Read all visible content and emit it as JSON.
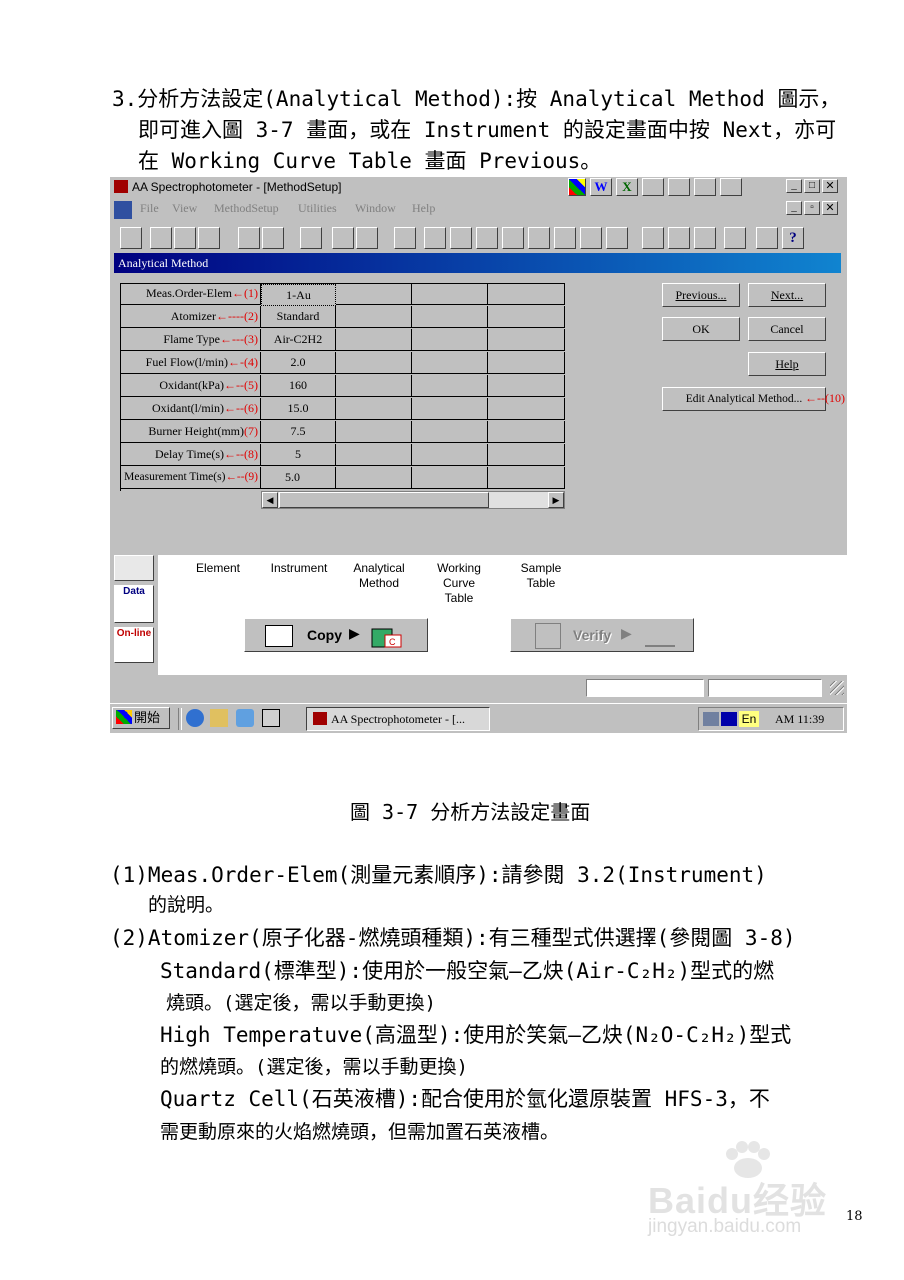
{
  "intro": {
    "line1": "3.分析方法設定(Analytical Method):按 Analytical Method 圖示，",
    "line2": "即可進入圖 3-7 畫面，或在 Instrument 的設定畫面中按 Next，亦可",
    "line3": "在 Working Curve Table 畫面 Previous。"
  },
  "window": {
    "title": "AA Spectrophotometer - [MethodSetup]",
    "menu": [
      "File",
      "View",
      "MethodSetup",
      "Utilities",
      "Window",
      "Help"
    ],
    "dialog_title": "Analytical Method",
    "params": [
      {
        "label": "Meas.Order-Elem",
        "mark": "←(1)",
        "value": "1-Au"
      },
      {
        "label": "Atomizer",
        "mark": "←----(2)",
        "value": "Standard"
      },
      {
        "label": "Flame Type",
        "mark": "←---(3)",
        "value": "Air-C2H2"
      },
      {
        "label": "Fuel Flow(l/min)",
        "mark": "←-(4)",
        "value": "2.0"
      },
      {
        "label": "Oxidant(kPa)",
        "mark": "←--(5)",
        "value": "160"
      },
      {
        "label": "Oxidant(l/min)",
        "mark": "←--(6)",
        "value": "15.0"
      },
      {
        "label": "Burner Height(mm)",
        "mark": "(7)",
        "value": "7.5"
      },
      {
        "label": "Delay Time(s)",
        "mark": "←--(8)",
        "value": "5"
      },
      {
        "label": "Measurement Time(s)",
        "mark": "←--(9)",
        "value": "5.0"
      }
    ],
    "buttons": {
      "previous": "Previous...",
      "next": "Next...",
      "ok": "OK",
      "cancel": "Cancel",
      "help": "Help",
      "edit": "Edit Analytical Method...",
      "edit_mark": "←--(10)"
    },
    "steps": [
      "Element",
      "Instrument",
      "Analytical\nMethod",
      "Working\nCurve\nTable",
      "Sample\nTable"
    ],
    "side_labels": {
      "data": "Data",
      "online": "On-line"
    },
    "copy": "Copy",
    "verify": "Verify",
    "taskbar": {
      "start": "開始",
      "task": "AA Spectrophotometer - [...",
      "lang": "En",
      "clock": "AM 11:39"
    }
  },
  "caption": "圖 3-7 分析方法設定畫面",
  "body": {
    "p1a": "(1)Meas.Order-Elem(測量元素順序):請參閱 3.2(Instrument)",
    "p1b": "的說明。",
    "p2a": "(2)Atomizer(原子化器-燃燒頭種類):有三種型式供選擇(參閱圖 3-8)",
    "p2b": "Standard(標準型):使用於一般空氣—乙炔(Air-C₂H₂)型式的燃",
    "p2c": "燒頭。(選定後，需以手動更換)",
    "p2d": "High Temperatuve(高溫型):使用於笑氣—乙炔(N₂O-C₂H₂)型式",
    "p2e": "的燃燒頭。(選定後，需以手動更換)",
    "p2f": "Quartz Cell(石英液槽):配合使用於氫化還原裝置 HFS-3，不",
    "p2g": "需更動原來的火焰燃燒頭，但需加置石英液槽。"
  },
  "watermark": {
    "brand": "Baidu经验",
    "url": "jingyan.baidu.com"
  },
  "page_number": "18"
}
